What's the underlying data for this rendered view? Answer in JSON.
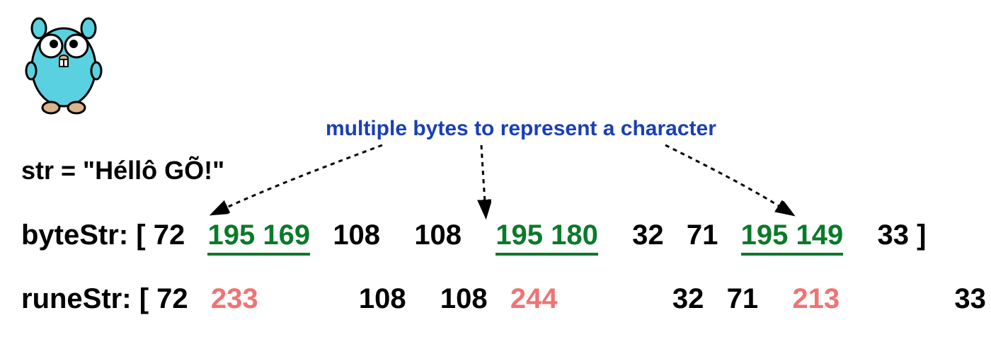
{
  "annotation": "multiple bytes to represent a character",
  "str_line": "str = \"Héllô GÕ!\"",
  "byte_label": "byteStr: ",
  "rune_label": "runeStr: ",
  "byte_row": {
    "open": "[",
    "a": "72",
    "g1": "195 169",
    "b": "108",
    "c": "108",
    "g2": "195 180",
    "d": "32",
    "e": "71",
    "g3": "195 149",
    "f": "33",
    "close": "]"
  },
  "rune_row": {
    "open": "[",
    "a": "72",
    "r1": "233",
    "b": "108",
    "c": "108",
    "r2": "244",
    "d": "32",
    "e": "71",
    "r3": "213",
    "f": "33",
    "close": "]"
  },
  "colors": {
    "annotation": "#1a3fb5",
    "multibyte": "#0a7a2a",
    "rune_highlight": "#f07373",
    "mascot_body": "#5ad1e0"
  }
}
